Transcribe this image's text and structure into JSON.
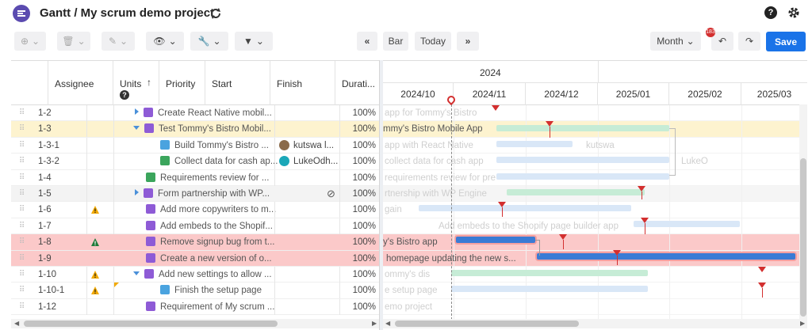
{
  "header": {
    "title": "Gantt / My scrum demo project"
  },
  "toolbar": {
    "bar_label": "Bar",
    "today_label": "Today",
    "month_label": "Month",
    "save_label": "Save",
    "badge": "183"
  },
  "grid": {
    "columns": [
      "Assignee",
      "Units",
      "Priority",
      "Start",
      "Finish",
      "Durati..."
    ],
    "rows": [
      {
        "wbs": "1-2",
        "name": "Create React Native mobil...",
        "pct": "100%",
        "assignee": ""
      },
      {
        "wbs": "1-3",
        "name": "Test Tommy's Bistro Mobil...",
        "pct": "100%",
        "assignee": ""
      },
      {
        "wbs": "1-3-1",
        "name": "Build Tommy's Bistro ...",
        "pct": "100%",
        "assignee": "kutswa l..."
      },
      {
        "wbs": "1-3-2",
        "name": "Collect data for cash ap...",
        "pct": "100%",
        "assignee": "LukeOdh..."
      },
      {
        "wbs": "1-4",
        "name": "Requirements review for ...",
        "pct": "100%",
        "assignee": ""
      },
      {
        "wbs": "1-5",
        "name": "Form partnership with WP...",
        "pct": "100%",
        "assignee": ""
      },
      {
        "wbs": "1-6",
        "name": "Add more copywriters to m...",
        "pct": "100%",
        "assignee": ""
      },
      {
        "wbs": "1-7",
        "name": "Add embeds to the Shopif...",
        "pct": "100%",
        "assignee": ""
      },
      {
        "wbs": "1-8",
        "name": "Remove signup bug from t...",
        "pct": "100%",
        "assignee": ""
      },
      {
        "wbs": "1-9",
        "name": "Create a new version of o...",
        "pct": "100%",
        "assignee": ""
      },
      {
        "wbs": "1-10",
        "name": "Add new settings to allow ...",
        "pct": "100%",
        "assignee": ""
      },
      {
        "wbs": "1-10-1",
        "name": "Finish the setup page",
        "pct": "100%",
        "assignee": ""
      },
      {
        "wbs": "1-12",
        "name": "Requirement of My scrum ...",
        "pct": "100%",
        "assignee": ""
      }
    ]
  },
  "timeline": {
    "year": "2024",
    "months": [
      "2024/10",
      "2024/11",
      "2024/12",
      "2025/01",
      "2025/02",
      "2025/03"
    ],
    "labels": [
      "app for Tommy's Bistro",
      "mmy's Bistro Mobile App",
      "app with React Native",
      "kutswa",
      "collect data for cash app",
      "LukeO",
      "requirements review for pre",
      "rtnership with WP Engine",
      "gain",
      "Add embeds to the Shopify page builder app",
      "y's Bistro app",
      "homepage updating the new s...",
      "ommy's dis",
      "e setup page",
      "emo project"
    ]
  },
  "colors": {
    "accent": "#1a73e8",
    "story": "#8e5bd6",
    "row_yellow": "#fdf3cf",
    "row_red": "#fbc9c9",
    "flag": "#d32f2f"
  }
}
